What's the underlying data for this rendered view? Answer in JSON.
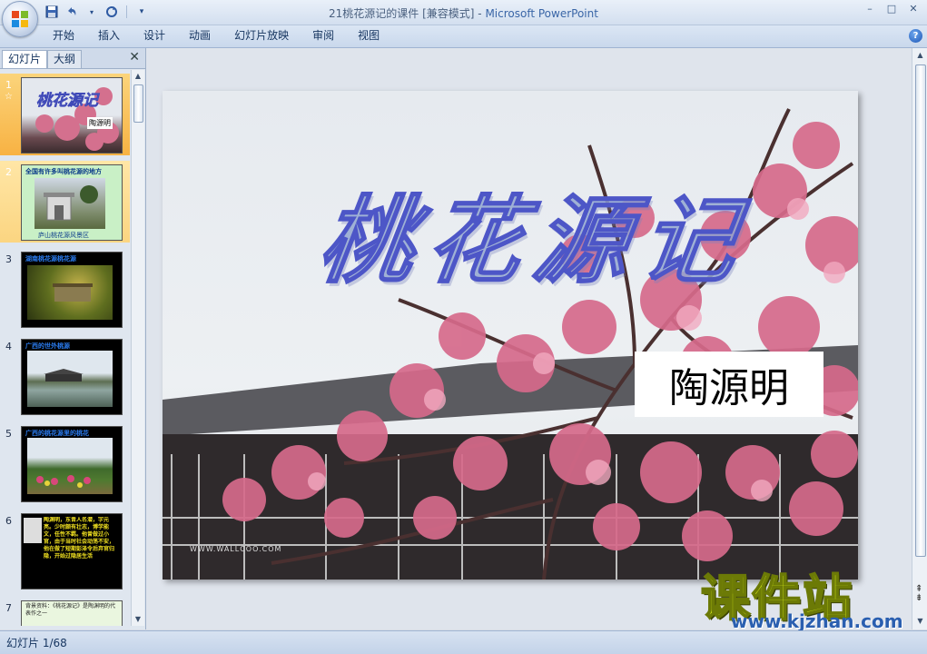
{
  "window": {
    "title_doc": "21桃花源记的课件 [兼容模式] - ",
    "title_app": "Microsoft PowerPoint",
    "minimize": "–",
    "maximize": "□",
    "close": "✕"
  },
  "qat": {
    "save_icon": "save-icon",
    "undo_icon": "undo-icon",
    "redo_icon": "redo-icon",
    "customize_icon": "customize-icon"
  },
  "ribbon": {
    "tabs": [
      "开始",
      "插入",
      "设计",
      "动画",
      "幻灯片放映",
      "审阅",
      "视图"
    ],
    "help": "?"
  },
  "left_panel": {
    "tab_slides": "幻灯片",
    "tab_outline": "大纲",
    "close": "✕",
    "thumbnails": [
      {
        "num": "1",
        "star": "☆",
        "title": "桃花源记",
        "sub": "陶源明"
      },
      {
        "num": "2",
        "caption_top": "全国有许多叫桃花源的地方",
        "caption_bottom": "庐山桃花源风景区"
      },
      {
        "num": "3",
        "caption_top": "湖南桃花源桃花源"
      },
      {
        "num": "4",
        "caption_top": "广西的世外桃源"
      },
      {
        "num": "5",
        "caption_top": "广西的桃花源里的桃花"
      },
      {
        "num": "6",
        "text": "陶渊明，东晋人名潜，字元亮。少时颇有壮志，博学能文，任性不羁。他曾做过小官，由于当时社会动荡不安，他在做了短期彭泽令后弃官归隐，开始过隐居生活"
      },
      {
        "num": "7",
        "text": "背景资料：《桃花源记》是陶渊明的代表作之一"
      }
    ]
  },
  "slide": {
    "title": "桃花源记",
    "author": "陶源明",
    "small_watermark": "WWW.WALLCOO.COM"
  },
  "overlay_logo": {
    "main": "课件站",
    "url": "www.kjzhan.com"
  },
  "status": {
    "slide_counter": "幻灯片 1/68"
  },
  "colors": {
    "title_stroke": "#4d56c7",
    "selected_thumb": "#f8b243",
    "logo": "#d9ef1a"
  }
}
